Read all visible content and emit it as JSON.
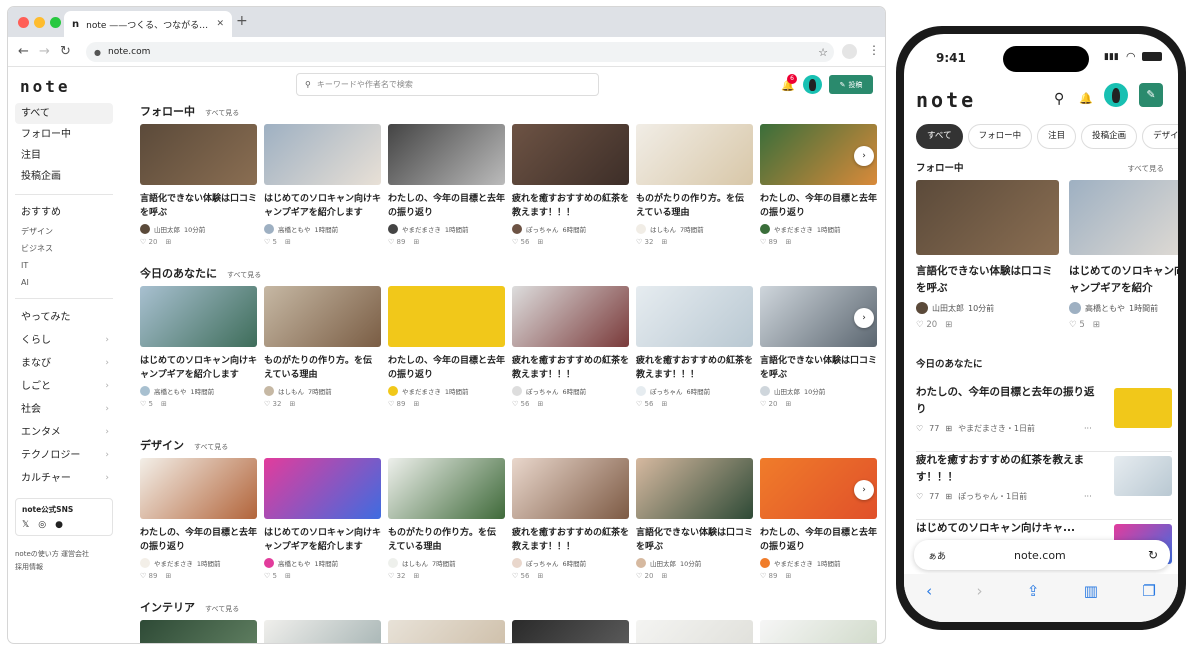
{
  "browser": {
    "tab_title": "note ——つくる、つながる…",
    "tab_favicon": "n",
    "url": "note.com"
  },
  "logo": "note",
  "search": {
    "placeholder": "キーワードや作者名で検索"
  },
  "notifications": {
    "count": "6"
  },
  "post_button": "投稿",
  "sidebar": {
    "main": [
      "すべて",
      "フォロー中",
      "注目",
      "投稿企画"
    ],
    "recommend_title": "おすすめ",
    "recommend": [
      "デザイン",
      "ビジネス",
      "IT",
      "AI"
    ],
    "categories": [
      "やってみた",
      "くらし",
      "まなび",
      "しごと",
      "社会",
      "エンタメ",
      "テクノロジー",
      "カルチャー"
    ],
    "sns_title": "note公式SNS",
    "footer": [
      "noteの使い方 運営会社",
      "採用情報"
    ]
  },
  "sections": [
    {
      "title": "フォロー中",
      "see_all": "すべて見る",
      "cards": [
        {
          "title": "言語化できない体験は口コミを呼ぶ",
          "author": "山田太郎",
          "time": "10分前",
          "likes": "20",
          "c": [
            "#5b4a3a",
            "#8a6e52"
          ]
        },
        {
          "title": "はじめてのソロキャン向けキャンプギアを紹介します",
          "author": "高橋ともや",
          "time": "1時間前",
          "likes": "5",
          "c": [
            "#9eb0c2",
            "#e8e0d6"
          ]
        },
        {
          "title": "わたしの、今年の目標と去年の振り返り",
          "author": "やまだまさき",
          "time": "1時間前",
          "likes": "89",
          "c": [
            "#444",
            "#bbb"
          ]
        },
        {
          "title": "疲れを癒すおすすめの紅茶を教えます！！！",
          "author": "ぽっちゃん",
          "time": "6時間前",
          "likes": "56",
          "c": [
            "#6d5344",
            "#3d2e28"
          ]
        },
        {
          "title": "ものがたりの作り方。を伝えている理由",
          "author": "はしもん",
          "time": "7時間前",
          "likes": "32",
          "c": [
            "#f1ede6",
            "#d8c7a8"
          ]
        },
        {
          "title": "わたしの、今年の目標と去年の振り返り",
          "author": "やまだまさき",
          "time": "1時間前",
          "likes": "89",
          "c": [
            "#3a6e3a",
            "#d98a3a"
          ]
        }
      ]
    },
    {
      "title": "今日のあなたに",
      "see_all": "すべて見る",
      "cards": [
        {
          "title": "はじめてのソロキャン向けキャンプギアを紹介します",
          "author": "高橋ともや",
          "time": "1時間前",
          "likes": "5",
          "c": [
            "#a8c0d0",
            "#3e6d5a"
          ]
        },
        {
          "title": "ものがたりの作り方。を伝えている理由",
          "author": "はしもん",
          "time": "7時間前",
          "likes": "32",
          "c": [
            "#c6b8a4",
            "#7a5d44"
          ]
        },
        {
          "title": "わたしの、今年の目標と去年の振り返り",
          "author": "やまだまさき",
          "time": "1時間前",
          "likes": "89",
          "c": [
            "#f1c81a",
            "#f1c81a"
          ]
        },
        {
          "title": "疲れを癒すおすすめの紅茶を教えます！！！",
          "author": "ぽっちゃん",
          "time": "6時間前",
          "likes": "56",
          "c": [
            "#ddd",
            "#7a3a3a"
          ]
        },
        {
          "title": "疲れを癒すおすすめの紅茶を教えます！！！",
          "author": "ぽっちゃん",
          "time": "6時間前",
          "likes": "56",
          "c": [
            "#e6ecf0",
            "#b9c8d2"
          ]
        },
        {
          "title": "言語化できない体験は口コミを呼ぶ",
          "author": "山田太郎",
          "time": "10分前",
          "likes": "20",
          "c": [
            "#cfd6dc",
            "#5b6670"
          ]
        }
      ]
    },
    {
      "title": "デザイン",
      "see_all": "すべて見る",
      "cards": [
        {
          "title": "わたしの、今年の目標と去年の振り返り",
          "author": "やまだまさき",
          "time": "1時間前",
          "likes": "89",
          "c": [
            "#f3efe8",
            "#b2643a"
          ]
        },
        {
          "title": "はじめてのソロキャン向けキャンプギアを紹介します",
          "author": "高橋ともや",
          "time": "1時間前",
          "likes": "5",
          "c": [
            "#e23c9c",
            "#3e6ce0"
          ]
        },
        {
          "title": "ものがたりの作り方。を伝えている理由",
          "author": "はしもん",
          "time": "7時間前",
          "likes": "32",
          "c": [
            "#eef0ec",
            "#3f6a3a"
          ]
        },
        {
          "title": "疲れを癒すおすすめの紅茶を教えます！！！",
          "author": "ぽっちゃん",
          "time": "6時間前",
          "likes": "56",
          "c": [
            "#e9d7cc",
            "#7d5a44"
          ]
        },
        {
          "title": "言語化できない体験は口コミを呼ぶ",
          "author": "山田太郎",
          "time": "10分前",
          "likes": "20",
          "c": [
            "#d6b9a0",
            "#2e4a36"
          ]
        },
        {
          "title": "わたしの、今年の目標と去年の振り返り",
          "author": "やまだまさき",
          "time": "1時間前",
          "likes": "89",
          "c": [
            "#f07c2a",
            "#e0502a"
          ]
        }
      ]
    },
    {
      "title": "インテリア",
      "see_all": "すべて見る",
      "cards": []
    }
  ],
  "phone": {
    "time": "9:41",
    "logo": "note",
    "tabs": [
      "すべて",
      "フォロー中",
      "注目",
      "投稿企画",
      "デザイ"
    ],
    "following": {
      "title": "フォロー中",
      "see_all": "すべて見る",
      "cards": [
        {
          "title": "言語化できない体験は口コミを呼ぶ",
          "author": "山田太郎",
          "time": "10分前",
          "likes": "20",
          "c": [
            "#5b4a3a",
            "#8a6e52"
          ]
        },
        {
          "title": "はじめてのソロキャン向けキャンプギアを紹介",
          "author": "高橋ともや",
          "time": "1時間前",
          "likes": "5",
          "c": [
            "#9eb0c2",
            "#e8e0d6"
          ]
        }
      ]
    },
    "today": {
      "title": "今日のあなたに",
      "rows": [
        {
          "title": "わたしの、今年の目標と去年の振り返り",
          "likes": "77",
          "meta": "やまだまさき・1日前",
          "c": [
            "#f1c81a",
            "#f1c81a"
          ]
        },
        {
          "title": "疲れを癒すおすすめの紅茶を教えます！！！",
          "likes": "77",
          "meta": "ぽっちゃん・1日前",
          "c": [
            "#e6ecf0",
            "#b9c8d2"
          ]
        },
        {
          "title": "はじめてのソロキャン向けキャ...",
          "likes": "",
          "meta": "",
          "c": [
            "#e23c9c",
            "#3e6ce0"
          ]
        }
      ]
    },
    "safari": {
      "aa": "ぁあ",
      "url": "note.com"
    }
  }
}
